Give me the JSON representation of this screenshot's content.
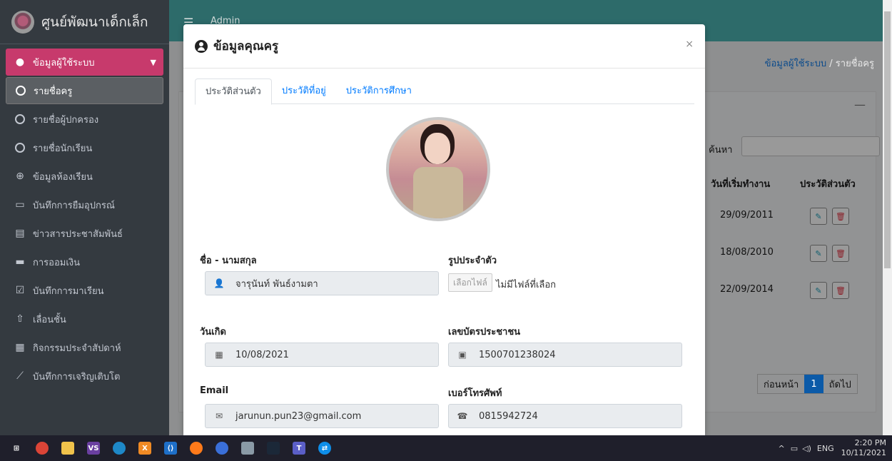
{
  "brand": {
    "name": "ศูนย์พัฒนาเด็กเล็ก"
  },
  "topbar": {
    "user": "Admin"
  },
  "sidebar": {
    "items": [
      {
        "label": "ข้อมูลผู้ใช้ระบบ",
        "icon": "user-circle-icon",
        "state": "active-parent"
      },
      {
        "label": "รายชื่อครู",
        "icon": "circle-icon",
        "state": "active-child"
      },
      {
        "label": "รายชื่อผู้ปกครอง",
        "icon": "circle-icon"
      },
      {
        "label": "รายชื่อนักเรียน",
        "icon": "circle-icon"
      },
      {
        "label": "ข้อมูลห้องเรียน",
        "icon": "plus-circle-icon"
      },
      {
        "label": "บันทึกการยืมอุปกรณ์",
        "icon": "laptop-icon"
      },
      {
        "label": "ข่าวสารประชาสัมพันธ์",
        "icon": "newspaper-icon"
      },
      {
        "label": "การออมเงิน",
        "icon": "wallet-icon"
      },
      {
        "label": "บันทึกการมาเรียน",
        "icon": "calendar-check-icon"
      },
      {
        "label": "เลื่อนชั้น",
        "icon": "arrow-up-circle-icon"
      },
      {
        "label": "กิจกรรมประจำสัปดาห์",
        "icon": "calendar-icon"
      },
      {
        "label": "บันทึกการเจริญเติบโต",
        "icon": "chart-line-icon"
      }
    ]
  },
  "breadcrumb": {
    "parent": "ข้อมูลผู้ใช้ระบบ",
    "separator": "/",
    "current": "รายชื่อครู"
  },
  "table": {
    "search_label": "ค้นหา",
    "headers": {
      "start_date": "วันที่เริ่มทำงาน",
      "profile": "ประวัติส่วนตัว"
    },
    "rows": [
      {
        "start_date": "29/09/2011"
      },
      {
        "start_date": "18/08/2010"
      },
      {
        "start_date": "22/09/2014"
      }
    ],
    "pager": {
      "prev": "ก่อนหน้า",
      "page": "1",
      "next": "ถัดไป"
    }
  },
  "modal": {
    "title": "ข้อมูลคุณครู",
    "close": "×",
    "tabs": [
      "ประวัติส่วนตัว",
      "ประวัติที่อยู่",
      "ประวัติการศึกษา"
    ],
    "fields": {
      "name_label": "ชื่อ - นามสกุล",
      "name_value": "จารุนันท์ พันธ์งามตา",
      "photo_label": "รูปประจำตัว",
      "file_button": "เลือกไฟล์",
      "file_status": "ไม่มีไฟล์ที่เลือก",
      "birth_label": "วันเกิด",
      "birth_value": "10/08/2021",
      "idcard_label": "เลขบัตรประชาชน",
      "idcard_value": "1500701238024",
      "email_label": "Email",
      "email_value": "jarunun.pun23@gmail.com",
      "phone_label": "เบอร์โทรศัพท์",
      "phone_value": "0815942724"
    }
  },
  "taskbar": {
    "tray_lang": "ENG",
    "time": "2:20 PM",
    "date": "10/11/2021"
  },
  "colors": {
    "sidebar": "#343a40",
    "active_parent": "#c73a6c",
    "topbar": "#2d6b6a",
    "link": "#007bff"
  }
}
